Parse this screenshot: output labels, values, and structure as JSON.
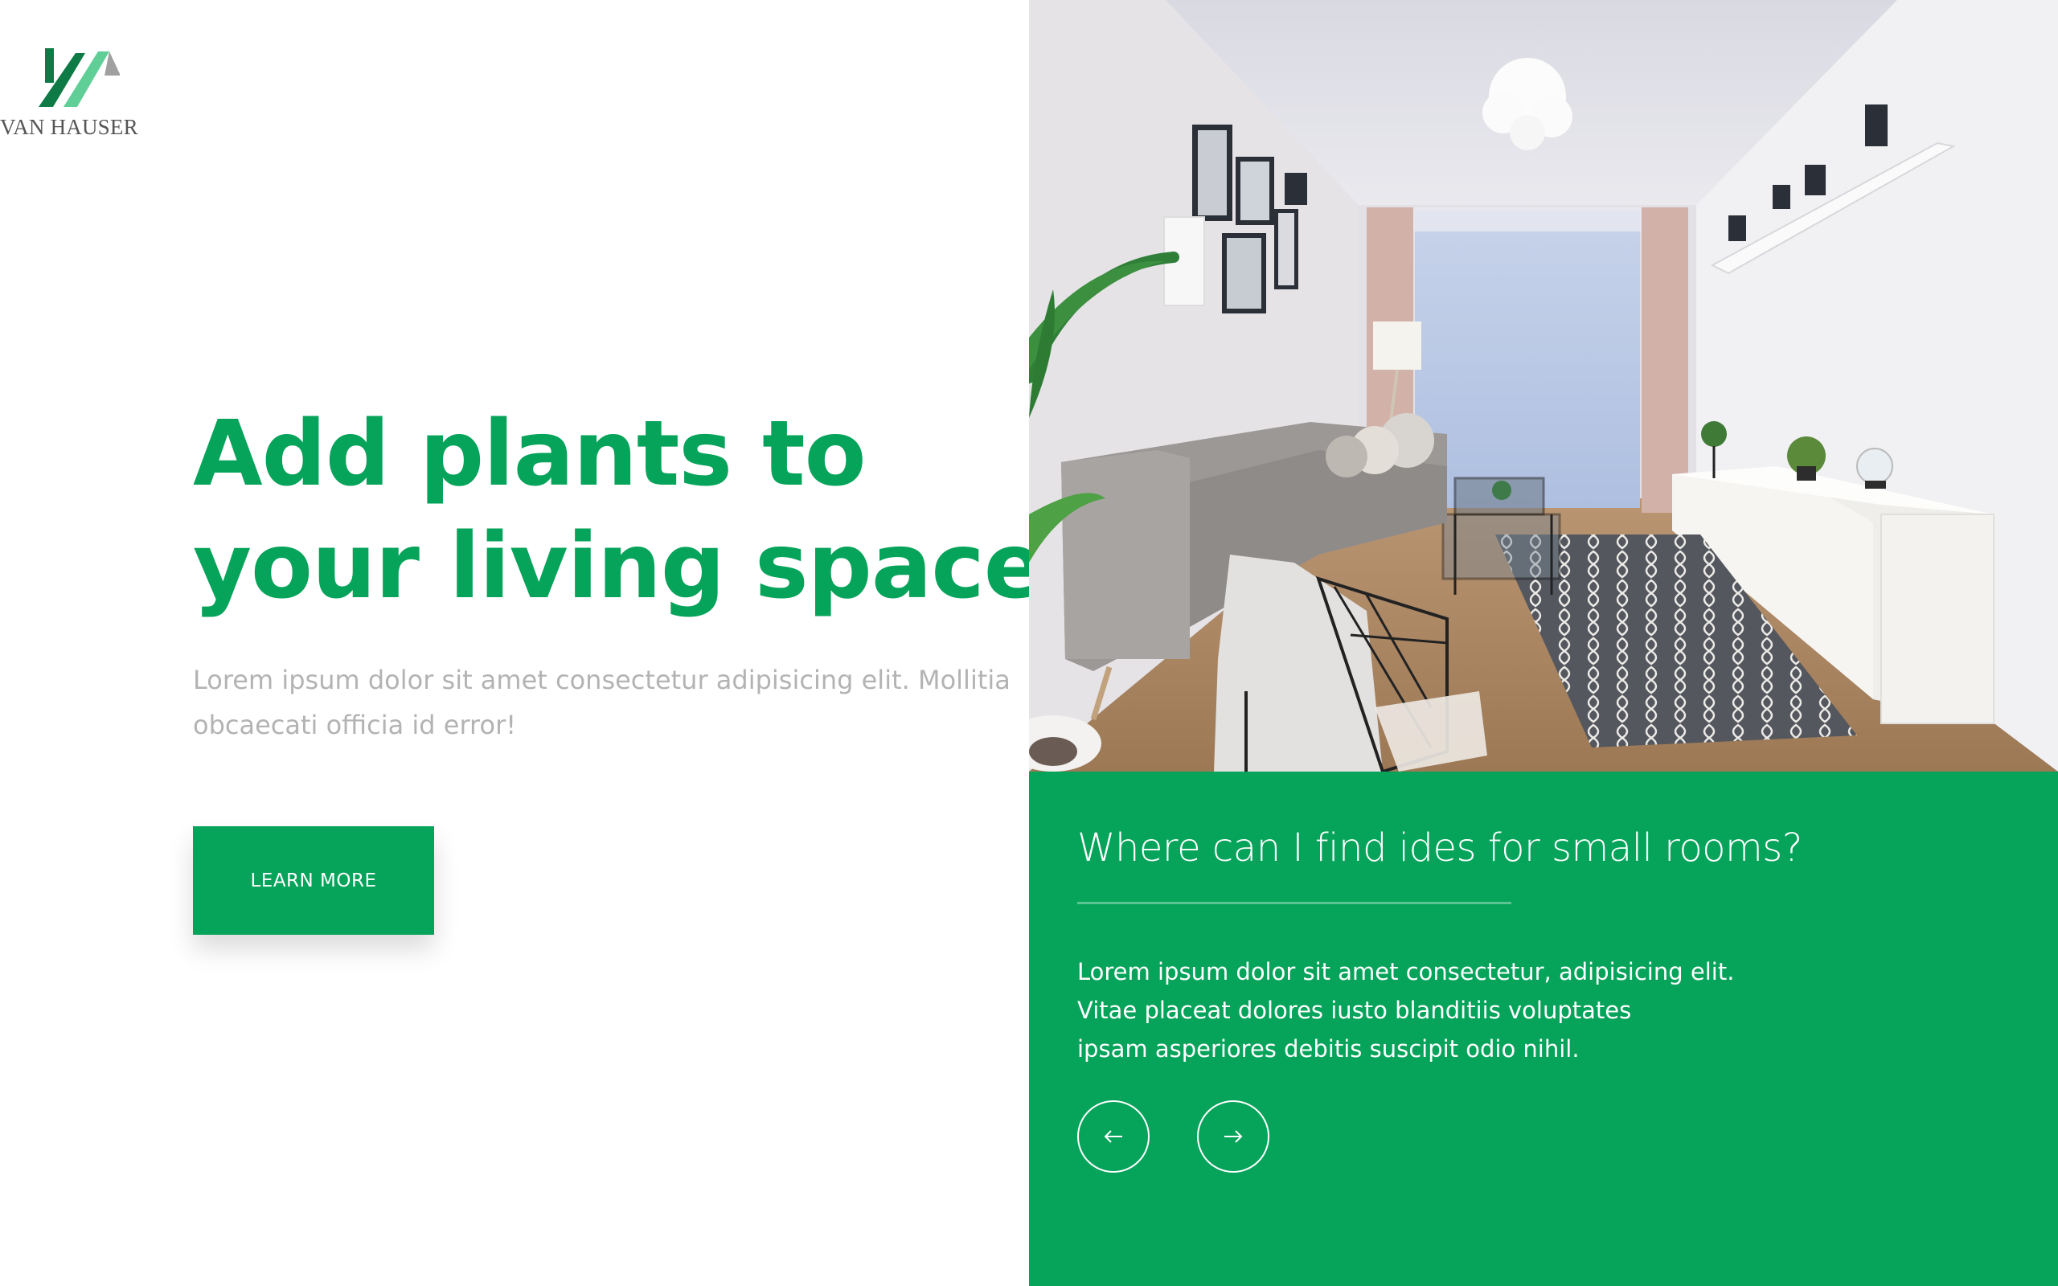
{
  "brand": {
    "name": "VAN HAUSER",
    "colors": {
      "primary": "#06a35a",
      "logo_dark": "#0e7a45",
      "logo_light": "#5fcf97",
      "logo_gray": "#a0a0a0"
    }
  },
  "hero": {
    "title_lines": [
      "Add plants to",
      "your living space"
    ],
    "description_lines": [
      "Lorem ipsum dolor sit amet consectetur adipisicing elit. Mollitia",
      "obcaecati officia id error!"
    ],
    "button_label": "LEARN MORE"
  },
  "feature_card": {
    "question": "Where can I find ides for small rooms?",
    "body_lines": [
      "Lorem ipsum dolor sit amet consectetur, adipisicing elit.",
      "Vitae placeat dolores iusto blanditiis voluptates",
      "ipsam asperiores debitis suscipit odio nihil."
    ],
    "prev_icon": "arrow-left-icon",
    "next_icon": "arrow-right-icon"
  },
  "photo": {
    "subject": "living-room-photo"
  }
}
